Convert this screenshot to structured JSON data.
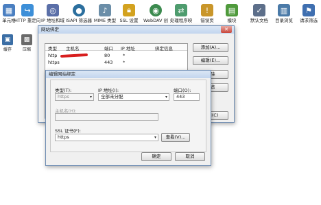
{
  "features": [
    {
      "label": "单元格",
      "icon": "cell-icon",
      "color": "#4a7fc1"
    },
    {
      "label": "HTTP 重定向",
      "icon": "redirect-icon",
      "color": "#3d8fd8"
    },
    {
      "label": "IP 地址和域",
      "icon": "ip-domain-icon",
      "color": "#5a6fa8"
    },
    {
      "label": "ISAPI 筛选器",
      "icon": "isapi-filter-icon",
      "color": "#2c6f9e"
    },
    {
      "label": "MIME 类型",
      "icon": "mime-icon",
      "color": "#6b8ea8"
    },
    {
      "label": "SSL 设置",
      "icon": "ssl-lock-icon",
      "color": "#d3a21f"
    },
    {
      "label": "WebDAV 创",
      "icon": "webdav-icon",
      "color": "#3b8a4e"
    },
    {
      "label": "处理程序映",
      "icon": "handler-mapping-icon",
      "color": "#4e9c6e"
    },
    {
      "label": "错误页",
      "icon": "error-page-icon",
      "color": "#c9962a"
    },
    {
      "label": "模块",
      "icon": "module-icon",
      "color": "#4f9a3c"
    },
    {
      "label": "默认文档",
      "icon": "default-doc-icon",
      "color": "#5d6f8a"
    },
    {
      "label": "目录浏览",
      "icon": "dir-browse-icon",
      "color": "#4a7aa8"
    },
    {
      "label": "请求筛选",
      "icon": "request-filter-icon",
      "color": "#3f6fb0"
    }
  ],
  "left_features": [
    {
      "label": "缓存",
      "icon": "cache-icon",
      "color": "#3b6ea5"
    },
    {
      "label": "压缩",
      "icon": "compress-icon",
      "color": "#6a6a6a"
    }
  ],
  "site_bindings": {
    "title": "网站绑定",
    "columns": [
      "类型",
      "主机名",
      "端口",
      "IP 地址",
      "绑定信息"
    ],
    "rows": [
      {
        "type": "http",
        "host": "",
        "port": "80",
        "ip": "*",
        "info": ""
      },
      {
        "type": "https",
        "host": "",
        "port": "443",
        "ip": "*",
        "info": ""
      }
    ],
    "buttons": {
      "add": "添加(A)...",
      "edit": "编辑(E)...",
      "remove": "删除",
      "browse": "浏览"
    },
    "close_label": "关闭(C)"
  },
  "edit_binding": {
    "title": "编辑网站绑定",
    "type_label": "类型(T):",
    "type_value": "https",
    "ip_label": "IP 地址(I):",
    "ip_value": "全部未分配",
    "port_label": "端口(O):",
    "port_value": "443",
    "host_label": "主机名(H):",
    "host_value": "",
    "ssl_label": "SSL 证书(F):",
    "ssl_value": "https",
    "view_button": "查看(V)...",
    "ok_button": "确定",
    "cancel_button": "取消"
  }
}
